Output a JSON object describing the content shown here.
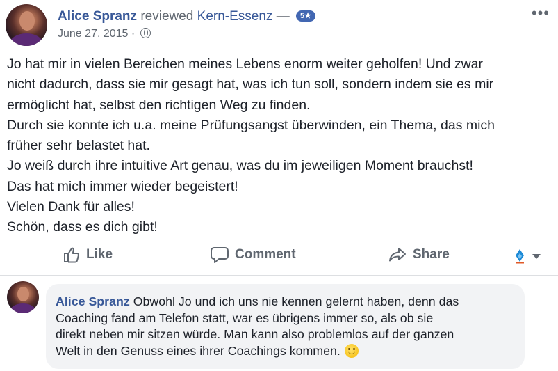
{
  "review": {
    "author": "Alice Spranz",
    "verb": "reviewed",
    "page_name": "Kern-Essenz",
    "dash": "—",
    "rating": "5★",
    "date": "June 27, 2015",
    "date_separator": "·",
    "privacy_icon": "globe-icon",
    "more_label": "•••",
    "body_lines": [
      "Jo hat mir in vielen Bereichen meines Lebens enorm weiter geholfen! Und zwar",
      "nicht dadurch, dass sie mir gesagt hat, was ich tun soll, sondern indem sie es mir",
      "ermöglicht hat, selbst den richtigen Weg zu finden.",
      "Durch sie konnte ich u.a. meine Prüfungsangst überwinden, ein Thema, das mich",
      "früher sehr belastet hat.",
      "Jo weiß durch ihre intuitive Art genau, was du im jeweiligen Moment brauchst!",
      "Das hat mich immer wieder begeistert!",
      "Vielen Dank für alles!",
      "Schön, dass es dich gibt!"
    ]
  },
  "actions": {
    "like_label": "Like",
    "comment_label": "Comment",
    "share_label": "Share",
    "like_icon": "thumbs-up-icon",
    "comment_icon": "speech-bubble-icon",
    "share_icon": "share-arrow-icon",
    "reaction_icon": "reaction-selector-icon"
  },
  "comment": {
    "author": "Alice Spranz",
    "lines": [
      "Obwohl Jo und ich uns nie kennen gelernt haben, denn das",
      "Coaching fand am Telefon statt, war es übrigens immer so, als ob sie",
      "direkt neben mir sitzen würde. Man kann also problemlos auf der ganzen",
      "Welt in den Genuss eines ihrer Coachings kommen."
    ],
    "emoji": "wink-emoji-icon"
  },
  "colors": {
    "link_blue": "#385898",
    "badge_blue": "#4267b2",
    "muted_gray": "#606770",
    "bubble_bg": "#f2f3f5"
  }
}
